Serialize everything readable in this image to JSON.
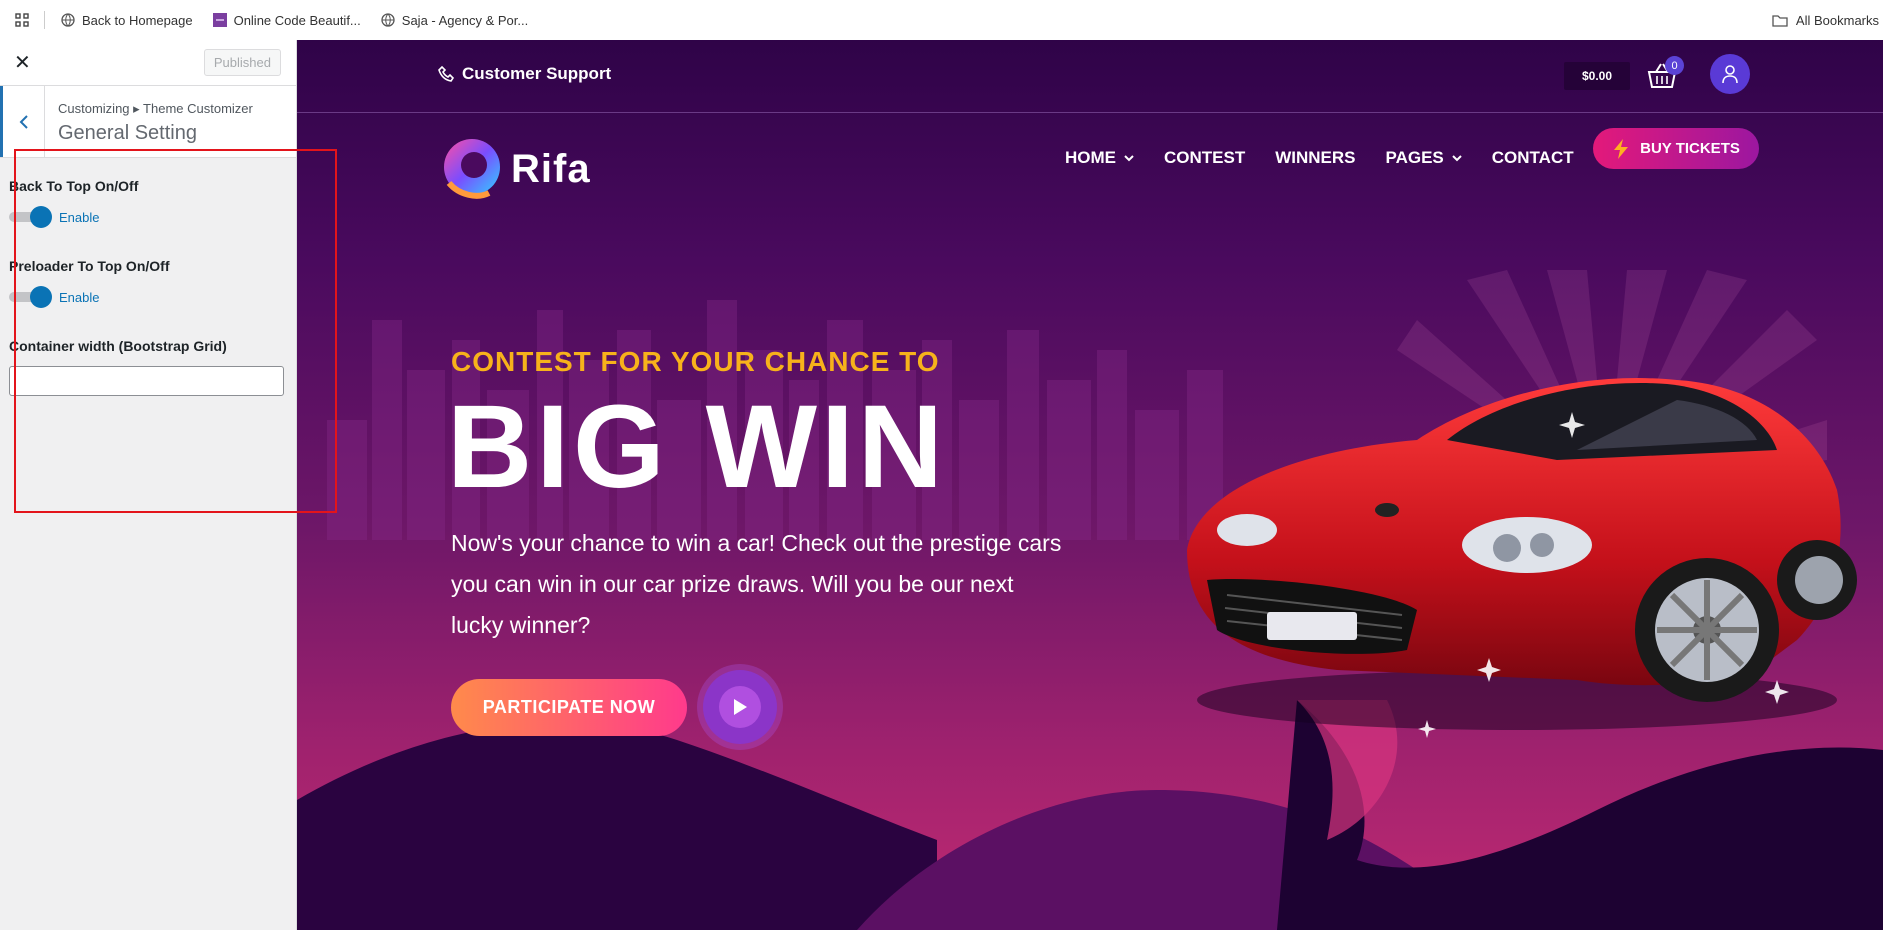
{
  "bookmarks": {
    "items": [
      {
        "label": "Back to Homepage",
        "icon": "globe-icon"
      },
      {
        "label": "Online Code Beautif...",
        "icon": "beautifier-icon"
      },
      {
        "label": "Saja - Agency & Por...",
        "icon": "globe-icon"
      }
    ],
    "all_bookmarks": "All Bookmarks"
  },
  "customizer": {
    "published_label": "Published",
    "breadcrumb": "Customizing ▸ Theme Customizer",
    "section_title": "General Setting",
    "back_to_top_label": "Back To Top On/Off",
    "back_to_top_state": "Enable",
    "preloader_label": "Preloader To Top On/Off",
    "preloader_state": "Enable",
    "container_width_label": "Container width (Bootstrap Grid)",
    "container_width_value": ""
  },
  "site": {
    "support_label": "Customer Support",
    "cart_total": "$0.00",
    "cart_count": "0",
    "logo_text": "Rifa",
    "nav": [
      {
        "label": "HOME",
        "has_dropdown": true
      },
      {
        "label": "CONTEST",
        "has_dropdown": false
      },
      {
        "label": "WINNERS",
        "has_dropdown": false
      },
      {
        "label": "PAGES",
        "has_dropdown": true
      },
      {
        "label": "CONTACT",
        "has_dropdown": false
      }
    ],
    "buy_tickets": "BUY TICKETS",
    "hero": {
      "subtitle": "CONTEST FOR YOUR CHANCE TO",
      "title": "BIG WIN",
      "description": "Now's your chance to win a car! Check out the prestige cars you can win in our car prize draws. Will you be our next lucky winner?",
      "cta": "PARTICIPATE NOW"
    },
    "colors": {
      "accent_orange": "#f7b21b",
      "button_pink": "#e3197a",
      "toggle_blue": "#0a73b5"
    }
  }
}
